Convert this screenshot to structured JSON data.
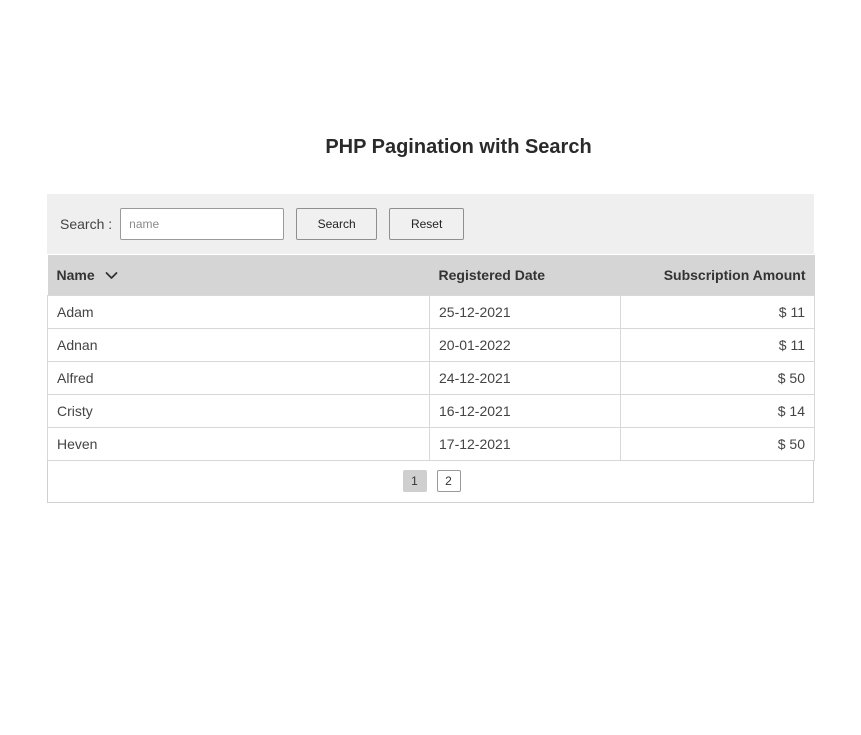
{
  "page": {
    "title": "PHP Pagination with Search"
  },
  "search": {
    "label": "Search :",
    "placeholder": "name",
    "value": "",
    "search_button": "Search",
    "reset_button": "Reset"
  },
  "table": {
    "headers": {
      "name": "Name",
      "date": "Registered Date",
      "amount": "Subscription Amount"
    },
    "sort_icon": "chevron-down-icon",
    "rows": [
      {
        "name": "Adam",
        "date": "25-12-2021",
        "amount": "$ 11"
      },
      {
        "name": "Adnan",
        "date": "20-01-2022",
        "amount": "$ 11"
      },
      {
        "name": "Alfred",
        "date": "24-12-2021",
        "amount": "$ 50"
      },
      {
        "name": "Cristy",
        "date": "16-12-2021",
        "amount": "$ 14"
      },
      {
        "name": "Heven",
        "date": "17-12-2021",
        "amount": "$ 50"
      }
    ]
  },
  "pagination": {
    "pages": [
      "1",
      "2"
    ],
    "current": "1"
  },
  "colors": {
    "search_bar_bg": "#efefef",
    "header_bg": "#d5d5d5",
    "active_page_bg": "#cfcfcf"
  }
}
